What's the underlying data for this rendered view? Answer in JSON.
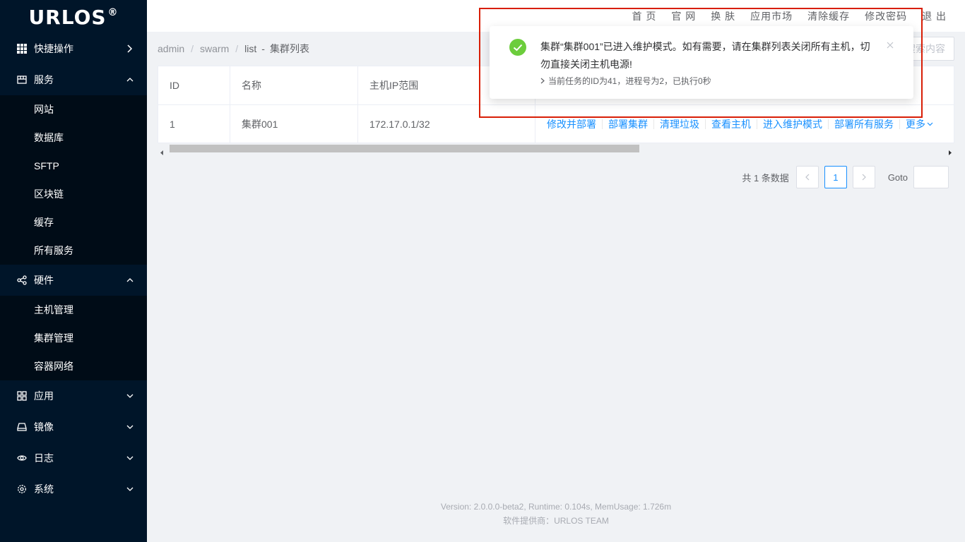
{
  "brand": {
    "name": "URLOS",
    "mark": "®"
  },
  "sidebar": {
    "quick": {
      "label": "快捷操作",
      "icon": "grid-icon",
      "arrow": "chevron-right-icon"
    },
    "service": {
      "label": "服务",
      "icon": "store-icon",
      "arrow": "chevron-up-icon",
      "items": [
        "网站",
        "数据库",
        "SFTP",
        "区块链",
        "缓存",
        "所有服务"
      ]
    },
    "hardware": {
      "label": "硬件",
      "icon": "share-icon",
      "arrow": "chevron-up-icon",
      "items": [
        "主机管理",
        "集群管理",
        "容器网络"
      ]
    },
    "app": {
      "label": "应用",
      "icon": "apps-icon",
      "arrow": "chevron-down-icon"
    },
    "image": {
      "label": "镜像",
      "icon": "drive-icon",
      "arrow": "chevron-down-icon"
    },
    "log": {
      "label": "日志",
      "icon": "eye-icon",
      "arrow": "chevron-down-icon"
    },
    "system": {
      "label": "系统",
      "icon": "gear-icon",
      "arrow": "chevron-down-icon"
    }
  },
  "topnav": [
    "首 页",
    "官 网",
    "换 肤",
    "应用市场",
    "清除缓存",
    "修改密码",
    "退 出"
  ],
  "breadcrumb": {
    "items": [
      "admin",
      "swarm",
      "list"
    ],
    "title": "集群列表"
  },
  "search_button": "搜索内容",
  "table": {
    "headers": [
      "ID",
      "名称",
      "主机IP范围"
    ],
    "rows": [
      {
        "id": "1",
        "name": "集群001",
        "ip": "172.17.0.1/32"
      }
    ],
    "actions": [
      "修改并部署",
      "部署集群",
      "清理垃圾",
      "查看主机",
      "进入维护模式",
      "部署所有服务"
    ],
    "more": "更多"
  },
  "pagination": {
    "total": "共 1 条数据",
    "page": "1",
    "goto": "Goto"
  },
  "footer": {
    "line1": "Version: 2.0.0.0-beta2,   Runtime: 0.104s,   MemUsage: 1.726m",
    "line2": "软件提供商：URLOS TEAM"
  },
  "notification": {
    "icon": "check-circle-icon",
    "title": "集群“集群001”已进入维护模式。如有需要，请在集群列表关闭所有主机，切勿直接关闭主机电源!",
    "detail": "当前任务的ID为41，进程号为2，已执行0秒",
    "success_color": "#52c41a"
  },
  "colors": {
    "sidebar": "#001529",
    "link": "#1890ff",
    "highlight": "#d81e06"
  }
}
